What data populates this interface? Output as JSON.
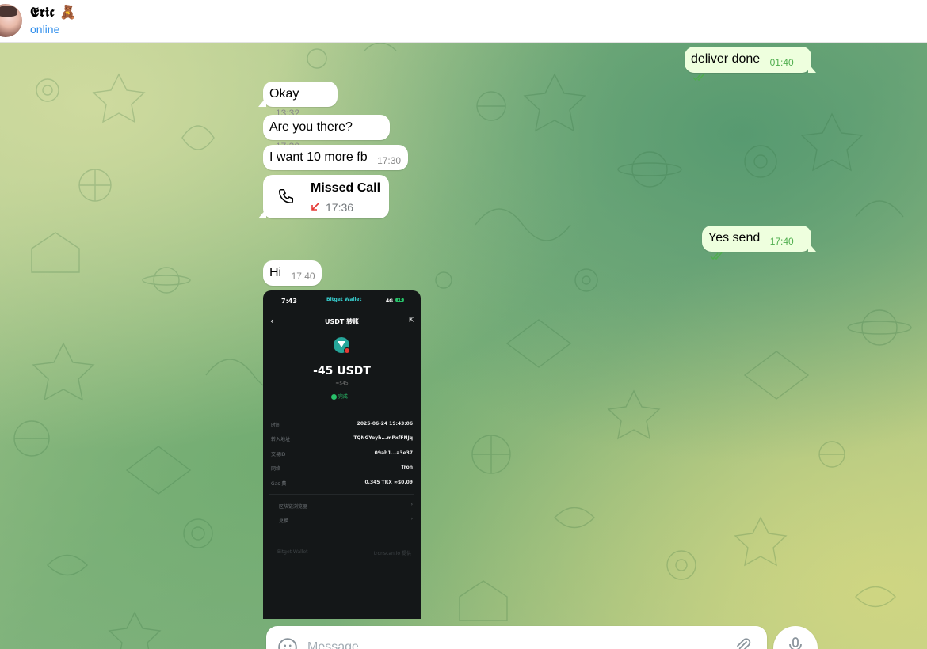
{
  "header": {
    "name": "𝕰𝖗𝖎𝖈 🧸",
    "status": "online"
  },
  "messages": [
    {
      "text": "deliver done",
      "time": "01:40",
      "dir": "out"
    },
    {
      "text": "Okay",
      "time": "13:32",
      "dir": "in"
    },
    {
      "text": "Are you there?",
      "time": "17:30",
      "dir": "in"
    },
    {
      "text": "I want 10 more fb",
      "time": "17:30",
      "dir": "in"
    },
    {
      "text": "Yes send",
      "time": "17:40",
      "dir": "out"
    },
    {
      "text": "Hi",
      "time": "17:40",
      "dir": "in"
    }
  ],
  "call": {
    "title": "Missed Call",
    "time": "17:36"
  },
  "screenshot": {
    "status_time": "7:43",
    "wallet_brand": "Bitget Wallet",
    "network": "4G",
    "battery": "78",
    "title": "USDT 转账",
    "amount": "-45 USDT",
    "fiat": "≈$45",
    "state": "完成",
    "rows": [
      {
        "label": "时间",
        "value": "2025-06-24 19:43:06"
      },
      {
        "label": "转入地址",
        "value": "TQNGYeyh...mPxfFNJq"
      },
      {
        "label": "交易ID",
        "value": "09ab1...a3e37"
      },
      {
        "label": "网络",
        "value": "Tron"
      },
      {
        "label": "Gas 费",
        "value": "0.345 TRX ≈$0.09"
      }
    ],
    "links": [
      "区块链浏览器",
      "兑换"
    ],
    "footer_brand": "Bitget Wallet",
    "footer_source": "tronscan.io 提供"
  },
  "composer": {
    "placeholder": "Message"
  },
  "icons": {
    "attach": "paperclip-icon",
    "emoji": "smile-icon",
    "mic": "microphone-icon",
    "phone": "phone-icon",
    "missed": "missed-call-arrow-icon",
    "read": "double-check-icon"
  },
  "colors": {
    "accent": "#3390ec",
    "outgoing_bubble": "#eeffde",
    "read_ticks": "#4fae4e",
    "missed": "#e53935"
  }
}
